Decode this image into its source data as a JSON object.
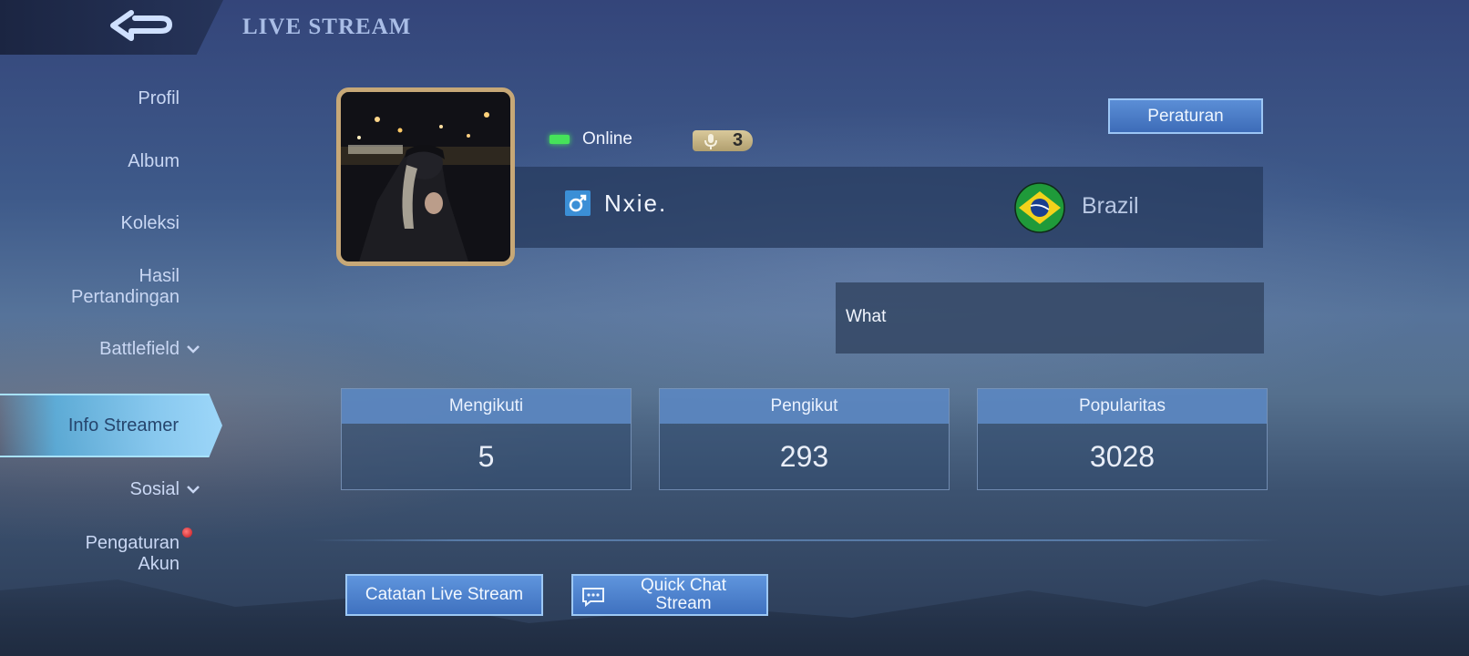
{
  "header": {
    "title": "LIVE STREAM"
  },
  "sidebar": {
    "items": [
      {
        "label": "Profil"
      },
      {
        "label": "Album"
      },
      {
        "label": "Koleksi"
      },
      {
        "label_line1": "Hasil",
        "label_line2": "Pertandingan"
      },
      {
        "label": "Battlefield",
        "icon": "chevron-down-icon"
      },
      {
        "label": "Info Streamer",
        "active": true
      },
      {
        "label": "Sosial",
        "icon": "chevron-down-icon"
      },
      {
        "label_line1": "Pengaturan",
        "label_line2": "Akun",
        "badge": "red-dot"
      }
    ]
  },
  "profile": {
    "status": "Online",
    "voice_count": "3",
    "name": "Nxie.",
    "gender_icon": "male-icon",
    "country": "Brazil",
    "flag_icon": "brazil-flag-icon",
    "bio": "What",
    "rules_label": "Peraturan"
  },
  "stats": [
    {
      "label": "Mengikuti",
      "value": "5"
    },
    {
      "label": "Pengikut",
      "value": "293"
    },
    {
      "label": "Popularitas",
      "value": "3028"
    }
  ],
  "actions": {
    "stream_log_label": "Catatan Live Stream",
    "quick_chat_line1": "Quick Chat",
    "quick_chat_line2": "Stream"
  },
  "colors": {
    "online": "#46e35a",
    "active_tab": "#8cd2fa",
    "button": "#4a7fcc",
    "avatar_frame": "#c7a877"
  }
}
